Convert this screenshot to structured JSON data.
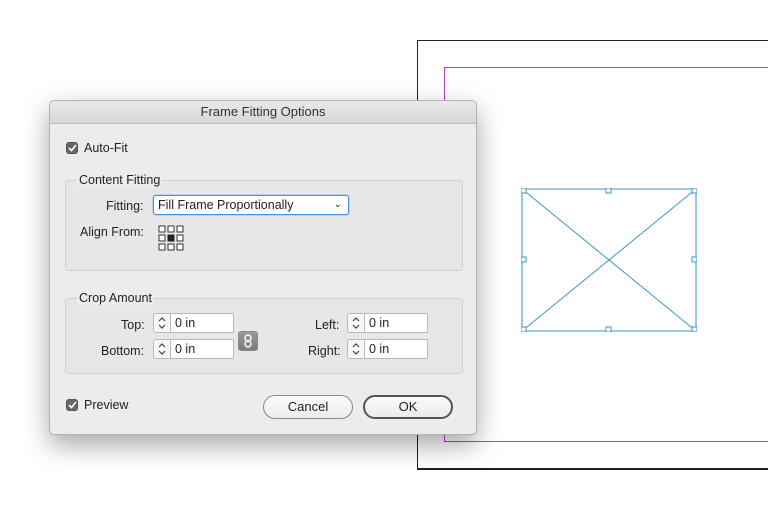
{
  "dialog": {
    "title": "Frame Fitting Options",
    "auto_fit": {
      "label": "Auto-Fit",
      "checked": true
    },
    "content_fitting": {
      "legend": "Content Fitting",
      "fitting_label": "Fitting:",
      "fitting_value": "Fill Frame Proportionally",
      "align_from_label": "Align From:",
      "align_from_selected": "center"
    },
    "crop_amount": {
      "legend": "Crop Amount",
      "top": {
        "label": "Top:",
        "value": "0 in"
      },
      "bottom": {
        "label": "Bottom:",
        "value": "0 in"
      },
      "left": {
        "label": "Left:",
        "value": "0 in"
      },
      "right": {
        "label": "Right:",
        "value": "0 in"
      },
      "link_icon": "chain-link-icon"
    },
    "preview": {
      "label": "Preview",
      "checked": true
    },
    "buttons": {
      "cancel": "Cancel",
      "ok": "OK"
    }
  },
  "colors": {
    "frame_stroke": "#3a96cc",
    "margin_guide": "#c03ccf",
    "focus_ring": "#4a90e2"
  }
}
